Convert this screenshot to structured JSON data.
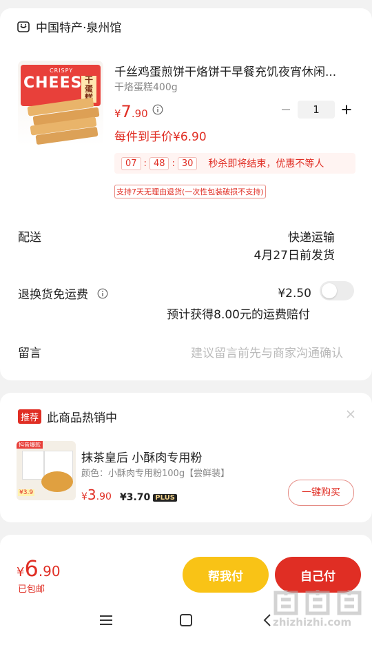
{
  "shop": {
    "icon": "shop-icon",
    "name": "中国特产·泉州馆"
  },
  "product": {
    "image_logo_text": "CHEESE",
    "image_badge_text": "CRISPY",
    "image_side_text": "干蛋糕",
    "title": "千丝鸡蛋煎饼干烙饼干早餐充饥夜宵休闲...",
    "spec": "干烙蛋糕400g",
    "price_symbol": "¥",
    "price_int": "7",
    "price_dec": ".90",
    "per_item_price": "每件到手价¥6.90",
    "quantity": "1",
    "countdown": {
      "h": "07",
      "m": "48",
      "s": "30"
    },
    "countdown_text": "秒杀即将结束，优惠不等人",
    "return_policy": "支持7天无理由退货(一次性包装破损不支持)"
  },
  "delivery": {
    "label": "配送",
    "method": "快递运输",
    "ship_date": "4月27日前发货"
  },
  "return_shipping": {
    "label": "退换货免运费",
    "price": "¥2.50",
    "note_prefix": "预计获得",
    "note_amount": "8.00",
    "note_suffix": "元的运费赔付"
  },
  "message": {
    "label": "留言",
    "placeholder": "建议留言前先与商家沟通确认"
  },
  "recommend": {
    "badge": "推荐",
    "title": "此商品热销中",
    "image_tag": "抖音爆款",
    "image_price": "¥3.9",
    "item_title": "抹茶皇后 小酥肉专用粉",
    "item_variant": "颜色：小酥肉专用粉100g【尝鲜装】",
    "price_symbol": "¥",
    "price_int": "3",
    "price_dec": ".90",
    "plus_price": "¥3.70",
    "plus_badge": "PLUS",
    "buy_button": "一键购买"
  },
  "footer": {
    "price_symbol": "¥",
    "price_int": "6",
    "price_dec": ".90",
    "shipping_note": "已包邮",
    "help_pay": "帮我付",
    "self_pay": "自己付"
  },
  "watermark": {
    "site": "zhizhizhi.com"
  },
  "colors": {
    "accent": "#e02e24",
    "yellow": "#f9c316",
    "bg": "#f2f2f2"
  }
}
